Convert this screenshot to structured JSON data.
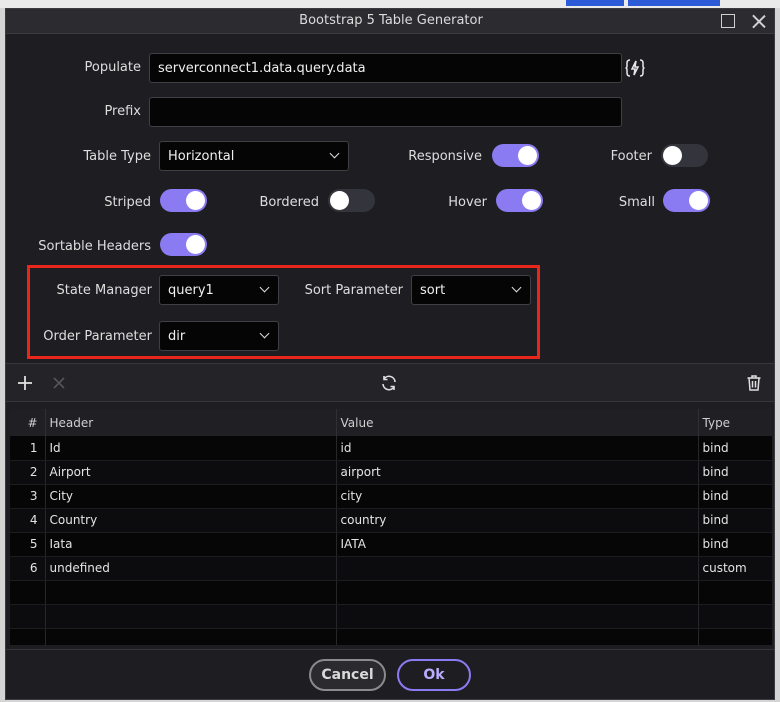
{
  "dialog": {
    "title": "Bootstrap 5 Table Generator"
  },
  "form": {
    "populate": {
      "label": "Populate",
      "value": "serverconnect1.data.query.data",
      "bind_icon": "lightning-brace-icon"
    },
    "prefix": {
      "label": "Prefix",
      "value": ""
    },
    "table_type": {
      "label": "Table Type",
      "value": "Horizontal"
    },
    "toggles": {
      "responsive": {
        "label": "Responsive",
        "on": true
      },
      "footer": {
        "label": "Footer",
        "on": false
      },
      "striped": {
        "label": "Striped",
        "on": true
      },
      "bordered": {
        "label": "Bordered",
        "on": false
      },
      "hover": {
        "label": "Hover",
        "on": true
      },
      "small": {
        "label": "Small",
        "on": true
      },
      "sortable_headers": {
        "label": "Sortable Headers",
        "on": true
      }
    },
    "state_manager": {
      "label": "State Manager",
      "value": "query1"
    },
    "sort_parameter": {
      "label": "Sort Parameter",
      "value": "sort"
    },
    "order_parameter": {
      "label": "Order Parameter",
      "value": "dir"
    }
  },
  "toolbar": {
    "add_icon": "plus-icon",
    "remove_icon": "x-icon",
    "refresh_icon": "refresh-icon",
    "delete_icon": "trash-icon"
  },
  "grid": {
    "columns": [
      "#",
      "Header",
      "Value",
      "Type"
    ],
    "rows": [
      {
        "num": "1",
        "header": "Id",
        "value": "id",
        "type": "bind"
      },
      {
        "num": "2",
        "header": "Airport",
        "value": "airport",
        "type": "bind"
      },
      {
        "num": "3",
        "header": "City",
        "value": "city",
        "type": "bind"
      },
      {
        "num": "4",
        "header": "Country",
        "value": "country",
        "type": "bind"
      },
      {
        "num": "5",
        "header": "Iata",
        "value": "IATA",
        "type": "bind"
      },
      {
        "num": "6",
        "header": "undefined",
        "value": "",
        "type": "custom"
      }
    ]
  },
  "buttons": {
    "cancel": "Cancel",
    "ok": "Ok"
  },
  "colors": {
    "accent": "#8b7bf2",
    "highlight": "#e8261c",
    "panel": "#1e1e22"
  }
}
